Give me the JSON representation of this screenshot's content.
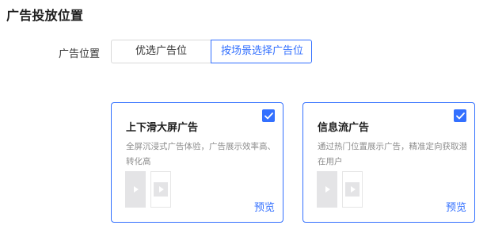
{
  "section": {
    "title": "广告投放位置"
  },
  "placement": {
    "label": "广告位置",
    "options": [
      {
        "label": "优选广告位",
        "selected": false
      },
      {
        "label": "按场景选择广告位",
        "selected": true
      }
    ]
  },
  "cards": [
    {
      "title": "上下滑大屏广告",
      "description": "全屏沉浸式广告体验，广告展示效率高、转化高",
      "preview_label": "预览",
      "checked": true,
      "icons": [
        "video-thumb-icon",
        "video-thumb-small-icon"
      ]
    },
    {
      "title": "信息流广告",
      "description": "通过热门位置展示广告，精准定向获取潜在用户",
      "preview_label": "预览",
      "checked": true,
      "icons": [
        "video-thumb-icon",
        "video-thumb-small-icon"
      ]
    }
  ],
  "colors": {
    "accent": "#3370ff",
    "text": "#1f1f1f",
    "muted": "#8c8c8c",
    "border": "#d9d9d9",
    "placeholder": "#e4e4e6"
  },
  "icons": {
    "check": "check-icon",
    "play": "play-icon"
  }
}
